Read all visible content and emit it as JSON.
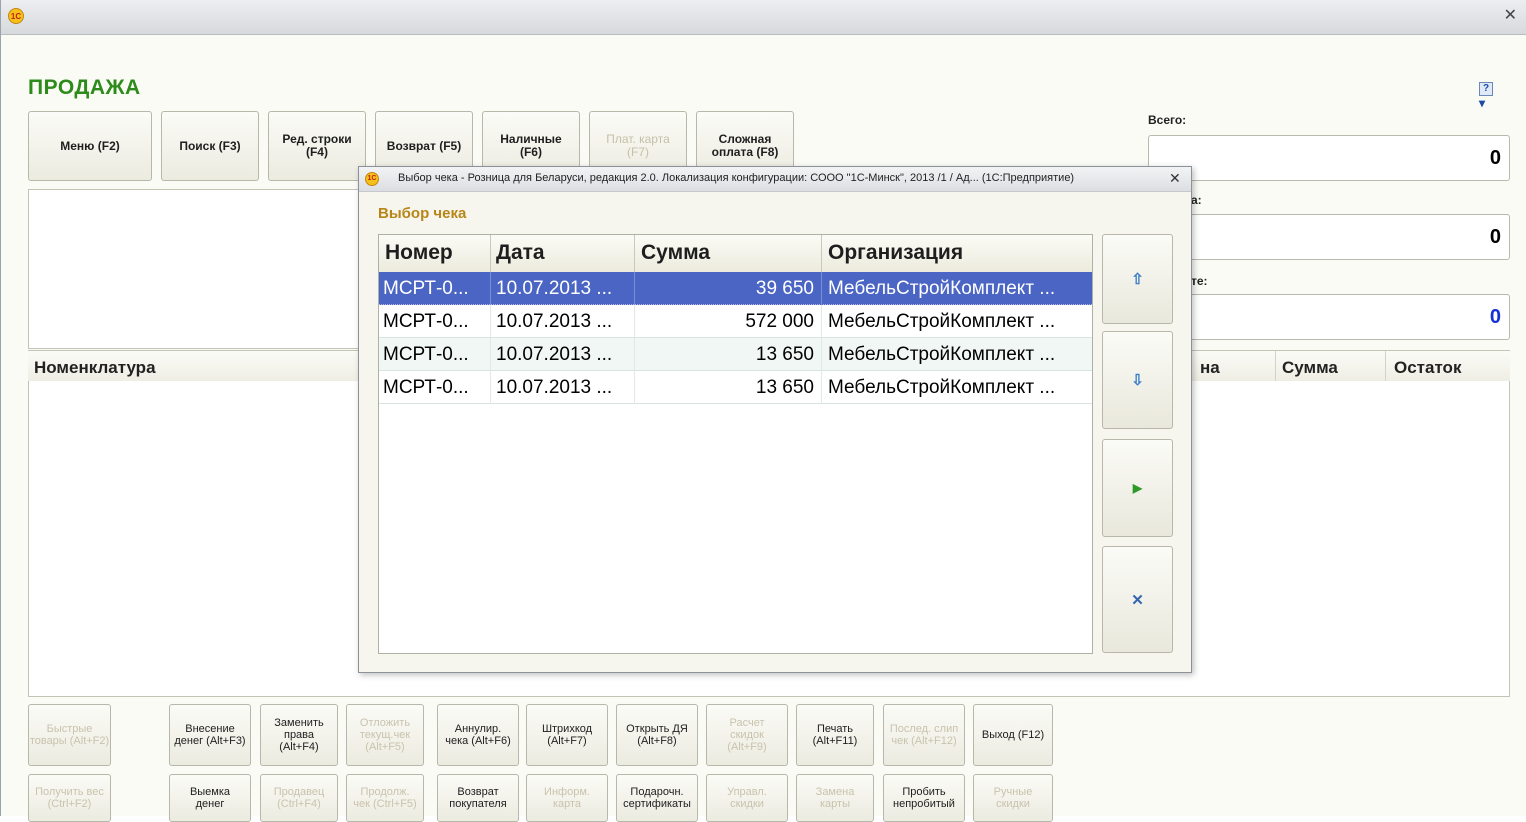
{
  "app": {
    "logo_text": "1C"
  },
  "page": {
    "title": "ПРОДАЖА"
  },
  "toolbar": [
    {
      "label": "Меню (F2)",
      "enabled": true
    },
    {
      "label": "Поиск (F3)",
      "enabled": true
    },
    {
      "label": "Ред. строки\n(F4)",
      "enabled": true
    },
    {
      "label": "Возврат (F5)",
      "enabled": true
    },
    {
      "label": "Наличные\n(F6)",
      "enabled": true
    },
    {
      "label": "Плат. карта\n(F7)",
      "enabled": false
    },
    {
      "label": "Сложная\nоплата (F8)",
      "enabled": true
    }
  ],
  "totals": {
    "total_label": "Всего:",
    "total_value": "0",
    "second_label_fragment": "а:",
    "second_value": "0",
    "third_label_fragment": "те:",
    "third_value": "0",
    "third_value_color": "#1530d8"
  },
  "main_table": {
    "columns": [
      "Номенклатура",
      "на",
      "Сумма",
      "Остаток"
    ]
  },
  "bottom_row1": [
    {
      "label": "Быстрые\nтовары (Alt+F2)",
      "enabled": false
    },
    {
      "label": "Внесение\nденег (Alt+F3)",
      "enabled": true
    },
    {
      "label": "Заменить\nправа\n(Alt+F4)",
      "enabled": true
    },
    {
      "label": "Отложить\nтекущ.чек\n(Alt+F5)",
      "enabled": false
    },
    {
      "label": "Аннулир.\nчека (Alt+F6)",
      "enabled": true
    },
    {
      "label": "Штрихкод\n(Alt+F7)",
      "enabled": true
    },
    {
      "label": "Открыть ДЯ\n(Alt+F8)",
      "enabled": true
    },
    {
      "label": "Расчет\nскидок\n(Alt+F9)",
      "enabled": false
    },
    {
      "label": "Печать\n(Alt+F11)",
      "enabled": true
    },
    {
      "label": "Послед. слип\nчек (Alt+F12)",
      "enabled": false
    },
    {
      "label": "Выход (F12)",
      "enabled": true
    }
  ],
  "bottom_row2": [
    {
      "label": "Получить вес\n(Ctrl+F2)",
      "enabled": false
    },
    {
      "label": "Выемка\nденег",
      "enabled": true
    },
    {
      "label": "Продавец\n(Ctrl+F4)",
      "enabled": false
    },
    {
      "label": "Продолж.\nчек (Ctrl+F5)",
      "enabled": false
    },
    {
      "label": "Возврат\nпокупателя",
      "enabled": true
    },
    {
      "label": "Информ.\nкарта",
      "enabled": false
    },
    {
      "label": "Подарочн.\nсертификаты",
      "enabled": true
    },
    {
      "label": "Управл.\nскидки",
      "enabled": false
    },
    {
      "label": "Замена\nкарты",
      "enabled": false
    },
    {
      "label": "Пробить\nнепробитый",
      "enabled": true
    },
    {
      "label": "Ручные\nскидки",
      "enabled": false
    }
  ],
  "modal": {
    "title": "Выбор чека - Розница для Беларуси, редакция 2.0. Локализация конфигурации: СООО \"1С-Минск\", 2013 /1 / Ад...  (1С:Предприятие)",
    "heading": "Выбор чека",
    "columns": [
      "Номер",
      "Дата",
      "Сумма",
      "Организация"
    ],
    "rows": [
      {
        "number": "МСРТ-0...",
        "date": "10.07.2013 ...",
        "sum": "39 650",
        "org": "МебельСтройКомплект ...",
        "selected": true
      },
      {
        "number": "МСРТ-0...",
        "date": "10.07.2013 ...",
        "sum": "572 000",
        "org": "МебельСтройКомплект ...",
        "selected": false
      },
      {
        "number": "МСРТ-0...",
        "date": "10.07.2013 ...",
        "sum": "13 650",
        "org": "МебельСтройКомплект ...",
        "selected": false
      },
      {
        "number": "МСРТ-0...",
        "date": "10.07.2013 ...",
        "sum": "13 650",
        "org": "МебельСтройКомплект ...",
        "selected": false
      }
    ],
    "side_buttons": [
      {
        "icon": "arrow-up-icon",
        "glyph": "⇧",
        "color": "#3a7ec8"
      },
      {
        "icon": "arrow-down-icon",
        "glyph": "⇩",
        "color": "#3a7ec8"
      },
      {
        "icon": "play-icon",
        "glyph": "▶",
        "color": "#2f9a2a"
      },
      {
        "icon": "cancel-icon",
        "glyph": "✕",
        "color": "#3466b0"
      }
    ]
  }
}
